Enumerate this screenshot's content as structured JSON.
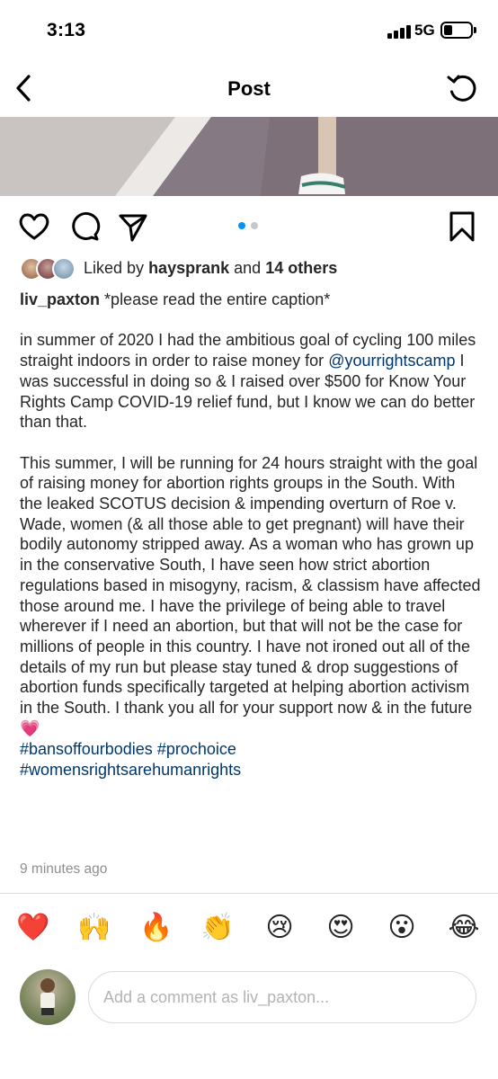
{
  "status_bar": {
    "time": "3:13",
    "network": "5G"
  },
  "header": {
    "title": "Post"
  },
  "carousel": {
    "total": 2,
    "active_index": 0
  },
  "likes": {
    "prefix": "Liked by",
    "user": "haysprank",
    "and": "and",
    "others": "14 others"
  },
  "caption": {
    "username": "liv_paxton",
    "intro": "*please read the entire caption*",
    "p1_before": "in summer of 2020 I had the ambitious goal of cycling 100 miles straight indoors in order to raise money for",
    "p1_mention": "@yourrightscamp",
    "p1_after": "I was successful in doing so & I raised over $500 for Know Your Rights Camp COVID-19 relief fund, but I know we can do better than that.",
    "p2": "This summer, I will be running for 24 hours straight with the goal of raising money for abortion rights groups in the South. With the leaked SCOTUS decision & impending overturn of Roe v. Wade, women (& all those able to get pregnant) will have their bodily autonomy stripped away. As a woman who has grown up in the conservative South, I have seen how strict abortion regulations based in misogyny, racism, & classism have affected those around me. I have the privilege of being able to travel wherever if I need an abortion, but that will not be the case for millions of people in this country. I have not ironed out all of the details of my run but please stay tuned & drop suggestions of abortion funds specifically targeted at helping abortion activism in the South. I thank you all for your support now & in the future",
    "p2_emoji": "💗",
    "hashtag1": "#bansoffourbodies",
    "hashtag2": "#prochoice",
    "hashtag3": "#womensrightsarehumanrights"
  },
  "timestamp": "9 minutes ago",
  "reactions": [
    "❤️",
    "🙌",
    "🔥",
    "👏",
    "😢",
    "😍",
    "😮",
    "😂"
  ],
  "comment": {
    "placeholder": "Add a comment as liv_paxton..."
  },
  "colors": {
    "link": "#00376b",
    "carousel_active": "#0095f6",
    "carousel_inactive": "#c7c7c7",
    "muted": "#8e8e8e"
  }
}
